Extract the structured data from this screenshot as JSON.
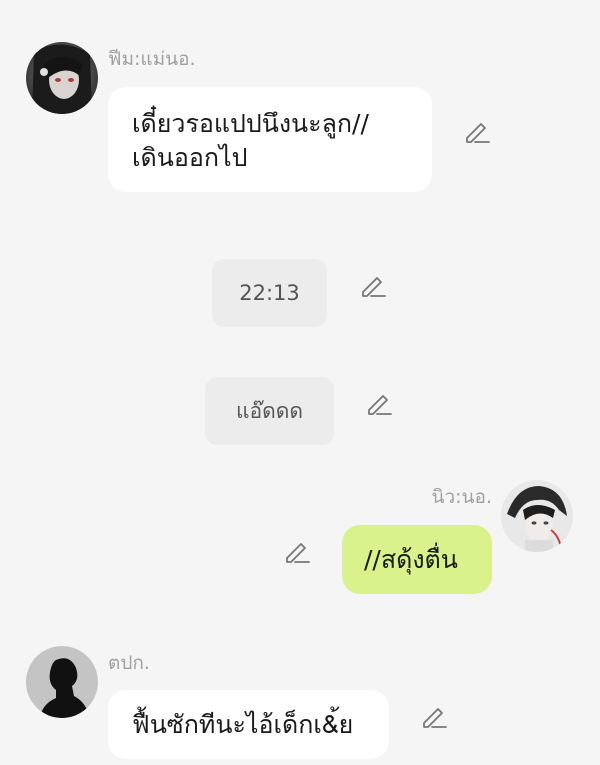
{
  "messages": [
    {
      "type": "incoming",
      "sender": "ฟีม:แม่นอ.",
      "text": "เดี๋ยวรอแปปนึงนะลูก//\nเดินออกไป"
    },
    {
      "type": "system",
      "text": "22:13"
    },
    {
      "type": "system",
      "text": "แอ๊ดดด"
    },
    {
      "type": "outgoing",
      "sender": "นิว:นอ.",
      "text": "//สดุ้งตื่น"
    },
    {
      "type": "incoming",
      "sender": "ตปก.",
      "text": "ฟื้นซักทีนะไอ้เด็กเ&้ย"
    }
  ],
  "icons": {
    "edit": "pencil-edit-icon",
    "avatar": "avatar-image"
  },
  "colors": {
    "background": "#f5f5f5",
    "incoming_bubble": "#ffffff",
    "outgoing_bubble": "#d9f28c",
    "system_bubble": "#ececec",
    "sender_name": "#a0a0a0"
  }
}
